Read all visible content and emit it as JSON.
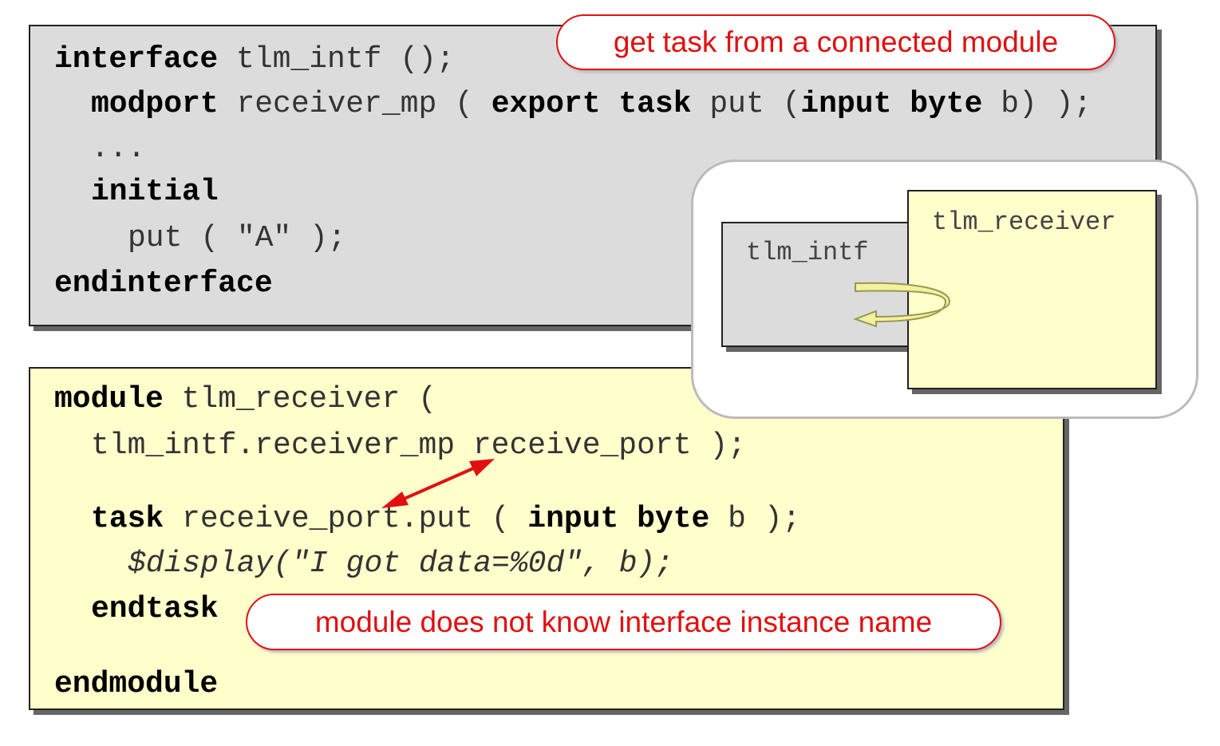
{
  "interface_code": [
    {
      "indent": 0,
      "segments": [
        {
          "t": "interface",
          "s": "b"
        },
        {
          "t": " tlm_intf ();",
          "s": "n"
        }
      ]
    },
    {
      "indent": 2,
      "segments": [
        {
          "t": "modport",
          "s": "b"
        },
        {
          "t": " receiver_mp ( ",
          "s": "n"
        },
        {
          "t": "export task",
          "s": "b"
        },
        {
          "t": " put (",
          "s": "n"
        },
        {
          "t": "input byte",
          "s": "b"
        },
        {
          "t": " b) );",
          "s": "n"
        }
      ]
    },
    {
      "indent": 2,
      "segments": [
        {
          "t": "...",
          "s": "n"
        }
      ]
    },
    {
      "indent": 2,
      "segments": [
        {
          "t": "initial",
          "s": "b"
        }
      ]
    },
    {
      "indent": 4,
      "segments": [
        {
          "t": "put ( \"A\" );",
          "s": "n"
        }
      ]
    },
    {
      "indent": 0,
      "segments": [
        {
          "t": "endinterface",
          "s": "b"
        }
      ]
    }
  ],
  "module_code": [
    {
      "indent": 0,
      "segments": [
        {
          "t": "module",
          "s": "b"
        },
        {
          "t": " tlm_receiver (",
          "s": "n"
        }
      ]
    },
    {
      "indent": 2,
      "segments": [
        {
          "t": "tlm_intf.receiver_mp receive_port );",
          "s": "n"
        }
      ]
    },
    {
      "indent": 2,
      "segments": [
        {
          "t": "task",
          "s": "b"
        },
        {
          "t": " receive_port.put ( ",
          "s": "n"
        },
        {
          "t": "input byte",
          "s": "b"
        },
        {
          "t": " b );",
          "s": "n"
        }
      ]
    },
    {
      "indent": 4,
      "segments": [
        {
          "t": "$display(\"I got data=%0d\", b);",
          "s": "i"
        }
      ]
    },
    {
      "indent": 2,
      "segments": [
        {
          "t": "endtask",
          "s": "b"
        }
      ]
    },
    {
      "indent": 0,
      "segments": [
        {
          "t": "endmodule",
          "s": "b"
        }
      ]
    }
  ],
  "callouts": {
    "top": "get task from a connected module",
    "bottom": "module does not know interface instance name"
  },
  "diagram": {
    "interface_label": "tlm_intf",
    "module_label": "tlm_receiver"
  },
  "colors": {
    "interface_bg": "#dcdcdc",
    "module_bg": "#ffffcc",
    "callout_red": "#e01010",
    "arrow_yellow": "#f2f2a0"
  }
}
